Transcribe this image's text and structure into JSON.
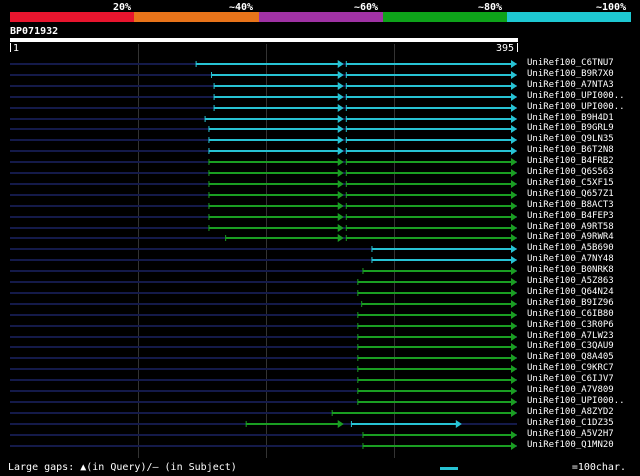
{
  "scale": {
    "labels": [
      "20%",
      "~40%",
      "~60%",
      "~80%",
      "~100%"
    ],
    "colors": [
      "#e8152e",
      "#e8741a",
      "#a032a4",
      "#0ea31a",
      "#1ec8d2"
    ]
  },
  "query": {
    "name": "BP071932",
    "start": "1",
    "end": "395",
    "length": 395
  },
  "hits": [
    {
      "name": "UniRef100_C6TNU7",
      "color": "#27c3d4",
      "segs": [
        [
          145,
          260
        ],
        [
          262,
          395
        ]
      ]
    },
    {
      "name": "UniRef100_B9R7X0",
      "color": "#27c3d4",
      "segs": [
        [
          157,
          260
        ],
        [
          262,
          395
        ]
      ]
    },
    {
      "name": "UniRef100_A7NTA3",
      "color": "#27c3d4",
      "segs": [
        [
          159,
          260
        ],
        [
          262,
          395
        ]
      ]
    },
    {
      "name": "UniRef100_UPI000..",
      "color": "#27c3d4",
      "segs": [
        [
          159,
          260
        ],
        [
          262,
          395
        ]
      ]
    },
    {
      "name": "UniRef100_UPI000..",
      "color": "#27c3d4",
      "segs": [
        [
          159,
          260
        ],
        [
          262,
          395
        ]
      ]
    },
    {
      "name": "UniRef100_B9H4D1",
      "color": "#27c3d4",
      "segs": [
        [
          152,
          260
        ],
        [
          262,
          395
        ]
      ]
    },
    {
      "name": "UniRef100_B9GRL9",
      "color": "#27c3d4",
      "segs": [
        [
          155,
          260
        ],
        [
          262,
          395
        ]
      ]
    },
    {
      "name": "UniRef100_Q9LN35",
      "color": "#27c3d4",
      "segs": [
        [
          155,
          260
        ],
        [
          262,
          395
        ]
      ]
    },
    {
      "name": "UniRef100_B6T2N8",
      "color": "#27c3d4",
      "segs": [
        [
          155,
          260
        ],
        [
          262,
          395
        ]
      ]
    },
    {
      "name": "UniRef100_B4FRB2",
      "color": "#1a9e22",
      "segs": [
        [
          155,
          260
        ],
        [
          262,
          395
        ]
      ]
    },
    {
      "name": "UniRef100_Q6S563",
      "color": "#1a9e22",
      "segs": [
        [
          155,
          260
        ],
        [
          262,
          395
        ]
      ]
    },
    {
      "name": "UniRef100_C5XF15",
      "color": "#1a9e22",
      "segs": [
        [
          155,
          260
        ],
        [
          262,
          395
        ]
      ]
    },
    {
      "name": "UniRef100_Q657Z1",
      "color": "#1a9e22",
      "segs": [
        [
          155,
          260
        ],
        [
          262,
          395
        ]
      ]
    },
    {
      "name": "UniRef100_B8ACT3",
      "color": "#1a9e22",
      "segs": [
        [
          155,
          260
        ],
        [
          262,
          395
        ]
      ]
    },
    {
      "name": "UniRef100_B4FEP3",
      "color": "#1a9e22",
      "segs": [
        [
          155,
          260
        ],
        [
          262,
          395
        ]
      ]
    },
    {
      "name": "UniRef100_A9RT58",
      "color": "#1a9e22",
      "segs": [
        [
          155,
          260
        ],
        [
          262,
          395
        ]
      ]
    },
    {
      "name": "UniRef100_A9RWR4",
      "color": "#1a9e22",
      "segs": [
        [
          168,
          260
        ],
        [
          262,
          395
        ]
      ]
    },
    {
      "name": "UniRef100_A5B690",
      "color": "#27c3d4",
      "segs": [
        [
          282,
          395
        ]
      ]
    },
    {
      "name": "UniRef100_A7NY48",
      "color": "#27c3d4",
      "segs": [
        [
          282,
          395
        ]
      ]
    },
    {
      "name": "UniRef100_B0NRK8",
      "color": "#1a9e22",
      "segs": [
        [
          275,
          395
        ]
      ]
    },
    {
      "name": "UniRef100_A5Z863",
      "color": "#1a9e22",
      "segs": [
        [
          271,
          395
        ]
      ]
    },
    {
      "name": "UniRef100_Q64N24",
      "color": "#1a9e22",
      "segs": [
        [
          271,
          395
        ]
      ]
    },
    {
      "name": "UniRef100_B9IZ96",
      "color": "#1a9e22",
      "segs": [
        [
          274,
          395
        ]
      ]
    },
    {
      "name": "UniRef100_C6IB80",
      "color": "#1a9e22",
      "segs": [
        [
          271,
          395
        ]
      ]
    },
    {
      "name": "UniRef100_C3R0P6",
      "color": "#1a9e22",
      "segs": [
        [
          271,
          395
        ]
      ]
    },
    {
      "name": "UniRef100_A7LW23",
      "color": "#1a9e22",
      "segs": [
        [
          271,
          395
        ]
      ]
    },
    {
      "name": "UniRef100_C3QAU9",
      "color": "#1a9e22",
      "segs": [
        [
          271,
          395
        ]
      ]
    },
    {
      "name": "UniRef100_Q8A405",
      "color": "#1a9e22",
      "segs": [
        [
          271,
          395
        ]
      ]
    },
    {
      "name": "UniRef100_C9KRC7",
      "color": "#1a9e22",
      "segs": [
        [
          271,
          395
        ]
      ]
    },
    {
      "name": "UniRef100_C6IJV7",
      "color": "#1a9e22",
      "segs": [
        [
          271,
          395
        ]
      ]
    },
    {
      "name": "UniRef100_A7V809",
      "color": "#1a9e22",
      "segs": [
        [
          271,
          395
        ]
      ]
    },
    {
      "name": "UniRef100_UPI000..",
      "color": "#1a9e22",
      "segs": [
        [
          271,
          395
        ]
      ]
    },
    {
      "name": "UniRef100_A8ZYD2",
      "color": "#1a9e22",
      "segs": [
        [
          251,
          395
        ]
      ]
    },
    {
      "name": "UniRef100_C1DZ35",
      "color": "#1a9e22",
      "segs": [
        [
          184,
          260
        ],
        [
          266,
          352
        ]
      ],
      "seg_colors": [
        "#1a9e22",
        "#27c3d4"
      ]
    },
    {
      "name": "UniRef100_A5V2H7",
      "color": "#1a9e22",
      "segs": [
        [
          275,
          395
        ]
      ]
    },
    {
      "name": "UniRef100_Q1MN20",
      "color": "#1a9e22",
      "segs": [
        [
          275,
          395
        ]
      ]
    }
  ],
  "footer": {
    "left": "Large gaps: ▲(in Query)/– (in Subject)",
    "right": "=100char."
  }
}
